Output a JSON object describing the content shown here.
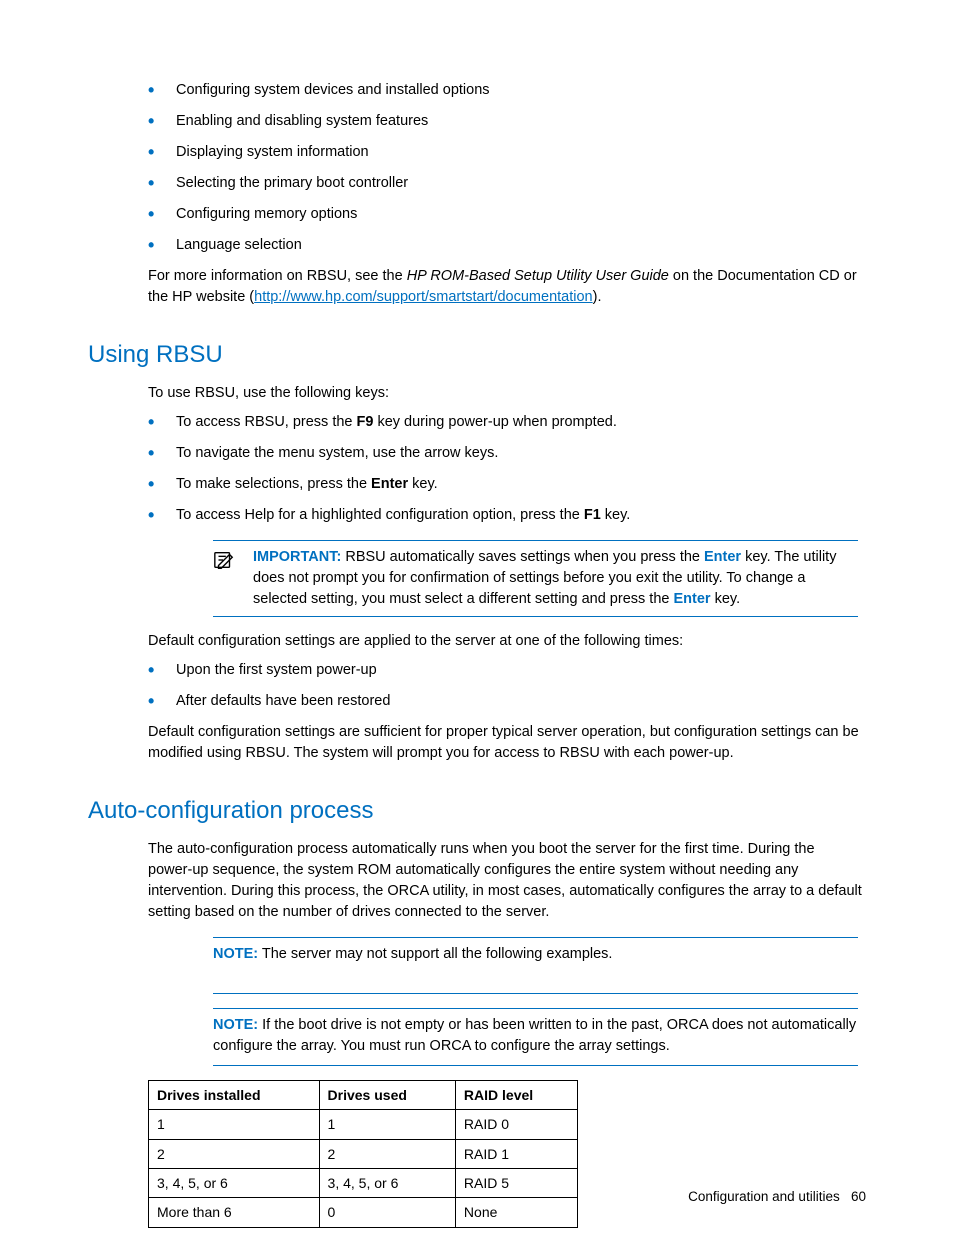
{
  "top_bullets": [
    "Configuring system devices and installed options",
    "Enabling and disabling system features",
    "Displaying system information",
    "Selecting the primary boot controller",
    "Configuring memory options",
    "Language selection"
  ],
  "top_info": {
    "pre": "For more information on RBSU, see the ",
    "italic": "HP ROM-Based Setup Utility User Guide",
    "mid": " on the Documentation CD or the HP website (",
    "link": "http://www.hp.com/support/smartstart/documentation",
    "post": ")."
  },
  "section1": {
    "title": "Using RBSU",
    "intro": "To use RBSU, use the following keys:",
    "bullets": [
      {
        "pre": "To access RBSU, press the ",
        "b1": "F9",
        "post": " key during power-up when prompted."
      },
      {
        "pre": "To navigate the menu system, use the arrow keys.",
        "b1": "",
        "post": ""
      },
      {
        "pre": "To make selections, press the ",
        "b1": "Enter",
        "post": " key."
      },
      {
        "pre": "To access Help for a highlighted configuration option, press the ",
        "b1": "F1",
        "post": " key."
      }
    ],
    "important": {
      "label": "IMPORTANT:",
      "t1": "  RBSU automatically saves settings when you press the ",
      "b1": "Enter",
      "t2": " key. The utility does not prompt you for confirmation of settings before you exit the utility. To change a selected setting, you must select a different setting and press the ",
      "b2": "Enter",
      "t3": " key."
    },
    "after_note": "Default configuration settings are applied to the server at one of the following times:",
    "times_bullets": [
      "Upon the first system power-up",
      "After defaults have been restored"
    ],
    "after_times": "Default configuration settings are sufficient for proper typical server operation, but configuration settings can be modified using RBSU. The system will prompt you for access to RBSU with each power-up."
  },
  "section2": {
    "title": "Auto-configuration process",
    "intro": "The auto-configuration process automatically runs when you boot the server for the first time. During the power-up sequence, the system ROM automatically configures the entire system without needing any intervention. During this process, the ORCA utility, in most cases, automatically configures the array to a default setting based on the number of drives connected to the server.",
    "note1": {
      "label": "NOTE:",
      "text": "  The server may not support all the following examples."
    },
    "note2": {
      "label": "NOTE:",
      "text": "  If the boot drive is not empty or has been written to in the past, ORCA does not automatically configure the array. You must run ORCA to configure the array settings."
    }
  },
  "table": {
    "headers": [
      "Drives installed",
      "Drives used",
      "RAID level"
    ],
    "rows": [
      [
        "1",
        "1",
        "RAID 0"
      ],
      [
        "2",
        "2",
        "RAID 1"
      ],
      [
        "3, 4, 5, or 6",
        "3, 4, 5, or 6",
        "RAID 5"
      ],
      [
        "More than 6",
        "0",
        "None"
      ]
    ]
  },
  "footer": {
    "section": "Configuration and utilities",
    "page": "60"
  },
  "chart_data": {
    "type": "table",
    "title": "RAID auto-configuration by installed drives",
    "columns": [
      "Drives installed",
      "Drives used",
      "RAID level"
    ],
    "rows": [
      {
        "Drives installed": "1",
        "Drives used": "1",
        "RAID level": "RAID 0"
      },
      {
        "Drives installed": "2",
        "Drives used": "2",
        "RAID level": "RAID 1"
      },
      {
        "Drives installed": "3, 4, 5, or 6",
        "Drives used": "3, 4, 5, or 6",
        "RAID level": "RAID 5"
      },
      {
        "Drives installed": "More than 6",
        "Drives used": "0",
        "RAID level": "None"
      }
    ]
  }
}
